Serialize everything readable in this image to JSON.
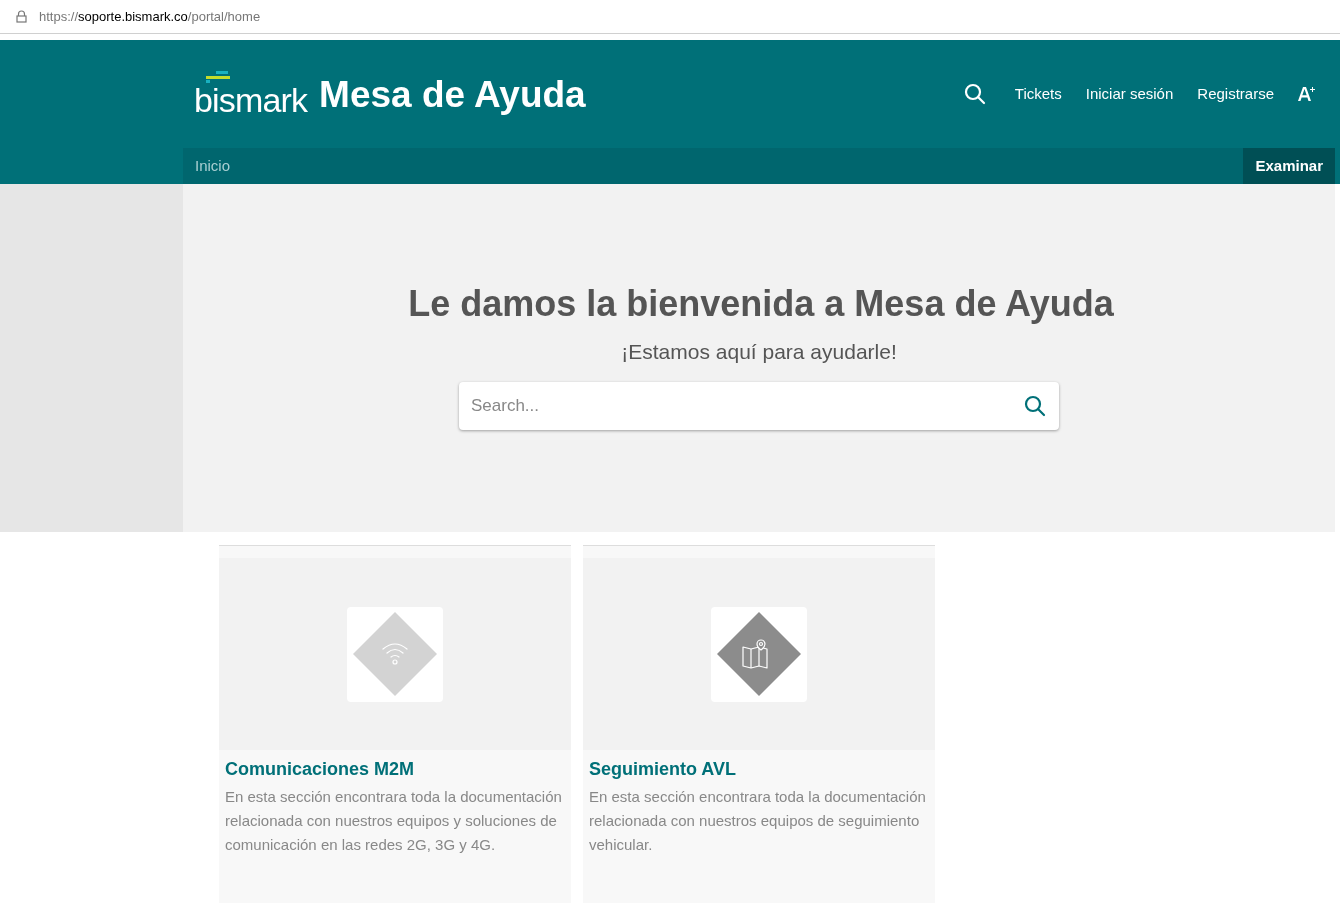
{
  "address_bar": {
    "scheme": "https://",
    "host": "soporte.bismark.co",
    "path": "/portal/home"
  },
  "header": {
    "logo": "bismark",
    "title": "Mesa de Ayuda",
    "links": [
      "Tickets",
      "Iniciar sesión",
      "Registrarse"
    ]
  },
  "nav": {
    "breadcrumb": "Inicio",
    "button": "Examinar"
  },
  "hero": {
    "title": "Le damos la bienvenida a Mesa de Ayuda",
    "subtitle": "¡Estamos aquí para ayudarle!",
    "search": {
      "placeholder": "Search..."
    }
  },
  "cards": [
    {
      "kind": "wifi",
      "color": "#d3d3d3",
      "title": "Comunicaciones M2M",
      "text": "En esta sección encontrara toda la documentación relacionada con nuestros equipos y soluciones de comunicación en las redes 2G, 3G y 4G."
    },
    {
      "kind": "map",
      "color": "#8c8c8c",
      "title": "Seguimiento AVL",
      "text": "En esta sección encontrara toda la documentación relacionada con nuestros equipos de seguimiento vehicular."
    }
  ]
}
